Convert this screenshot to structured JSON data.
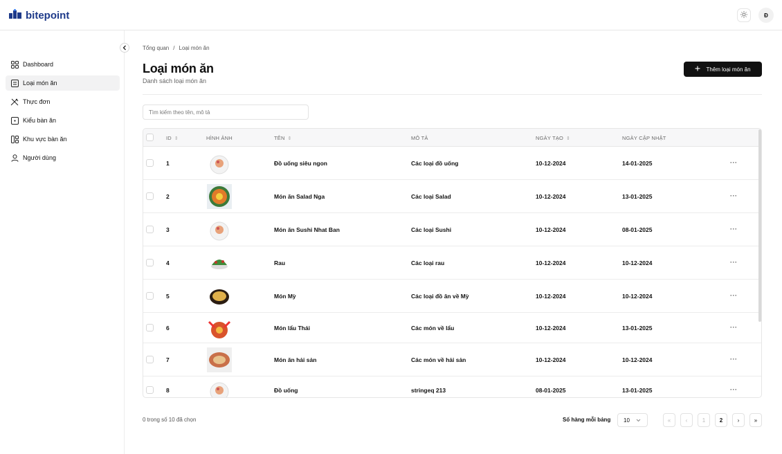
{
  "brand": {
    "name": "bitepoint"
  },
  "header": {
    "theme_icon": "sun-icon",
    "avatar_initial": "Đ"
  },
  "sidebar": {
    "items": [
      {
        "label": "Dashboard",
        "icon": "dashboard-icon"
      },
      {
        "label": "Loại món ăn",
        "icon": "list-icon",
        "active": true
      },
      {
        "label": "Thực đơn",
        "icon": "utensils-icon"
      },
      {
        "label": "Kiểu bàn ăn",
        "icon": "square-icon"
      },
      {
        "label": "Khu vực bàn ăn",
        "icon": "layout-icon"
      },
      {
        "label": "Người dùng",
        "icon": "user-icon"
      }
    ]
  },
  "breadcrumb": {
    "root": "Tổng quan",
    "separator": "/",
    "current": "Loại món ăn"
  },
  "page": {
    "title": "Loại món ăn",
    "subtitle": "Danh sách loại món ăn",
    "add_button": "Thêm loại món ăn"
  },
  "search": {
    "placeholder": "Tìm kiếm theo tên, mô tả",
    "value": ""
  },
  "table": {
    "headers": {
      "id": "ID",
      "image": "HÌNH ẢNH",
      "name": "TÊN",
      "desc": "MÔ TẢ",
      "created": "NGÀY TẠO",
      "updated": "NGÀY CẬP NHẬT"
    },
    "rows": [
      {
        "id": "1",
        "name": "Đồ uống siêu ngon",
        "desc": "Các loại đồ uống",
        "created": "10-12-2024",
        "updated": "14-01-2025",
        "img": "plate"
      },
      {
        "id": "2",
        "name": "Món ăn Salad Nga",
        "desc": "Các loại Salad",
        "created": "10-12-2024",
        "updated": "13-01-2025",
        "img": "salad"
      },
      {
        "id": "3",
        "name": "Món ăn Sushi Nhat Ban",
        "desc": "Các loại Sushi",
        "created": "10-12-2024",
        "updated": "08-01-2025",
        "img": "plate"
      },
      {
        "id": "4",
        "name": "Rau",
        "desc": "Các loại rau",
        "created": "10-12-2024",
        "updated": "10-12-2024",
        "img": "greens"
      },
      {
        "id": "5",
        "name": "Món Mỳ",
        "desc": "Các loại đồ ăn về Mỳ",
        "created": "10-12-2024",
        "updated": "10-12-2024",
        "img": "noodle"
      },
      {
        "id": "6",
        "name": "Món lẩu Thái",
        "desc": "Các món về lẩu",
        "created": "10-12-2024",
        "updated": "13-01-2025",
        "img": "hotpot"
      },
      {
        "id": "7",
        "name": "Món ăn hải sản",
        "desc": "Các món về hải sản",
        "created": "10-12-2024",
        "updated": "10-12-2024",
        "img": "seafood"
      },
      {
        "id": "8",
        "name": "Đồ uống",
        "desc": "stringeq 213",
        "created": "08-01-2025",
        "updated": "13-01-2025",
        "img": "plate"
      }
    ],
    "row_action": "···"
  },
  "footer": {
    "selection_text": "0 trong số 10 đã chọn",
    "rows_per_page_label": "Số hàng mỗi bảng",
    "rows_per_page_value": "10",
    "pages": [
      "1",
      "2"
    ],
    "current_page": "2",
    "first": "«",
    "prev": "‹",
    "next": "›",
    "last": "»"
  },
  "colors": {
    "brand": "#1e3a8a",
    "accent": "#111111"
  }
}
